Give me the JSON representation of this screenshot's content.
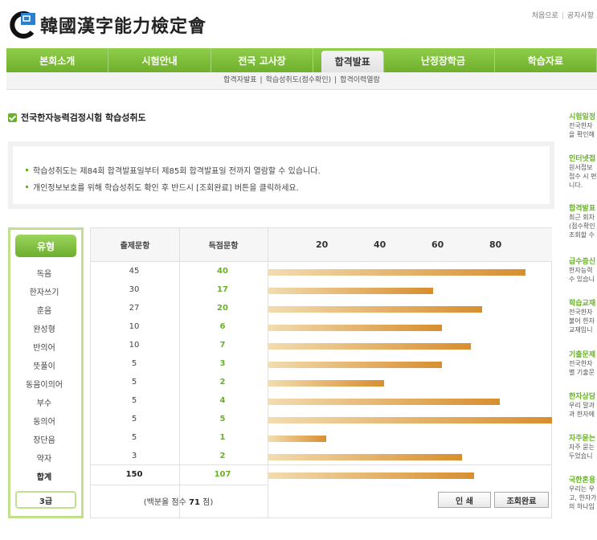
{
  "header": {
    "logo_text": "韓國漢字能力檢定會",
    "top_links": [
      "처음으로",
      "공지사항"
    ]
  },
  "nav": {
    "items": [
      "본회소개",
      "시험안내",
      "전국 고사장",
      "합격발표",
      "난정장학금",
      "학습자료"
    ],
    "active_index": 3
  },
  "subnav": {
    "items": [
      "합격자발표",
      "학습성취도(점수확인)",
      "합격이력열람"
    ],
    "separator": "|"
  },
  "section_title": "전국한자능력검정시험 학습성취도",
  "notice": [
    "학습성취도는 제84회 합격발표일부터 제85회 합격발표일 전까지 열람할 수 있습니다.",
    "개인정보보호를 위해 학습성취도 확인 후 반드시 [조회완료] 버튼을 클릭하세요."
  ],
  "table": {
    "type_label": "유형",
    "col_questions": "출제문항",
    "col_score": "득점문항",
    "axis_ticks": [
      "20",
      "40",
      "60",
      "80"
    ],
    "rows": [
      {
        "label": "독음",
        "questions": "45",
        "score": "40"
      },
      {
        "label": "한자쓰기",
        "questions": "30",
        "score": "17"
      },
      {
        "label": "훈음",
        "questions": "27",
        "score": "20"
      },
      {
        "label": "완성형",
        "questions": "10",
        "score": "6"
      },
      {
        "label": "반의어",
        "questions": "10",
        "score": "7"
      },
      {
        "label": "뜻풀이",
        "questions": "5",
        "score": "3"
      },
      {
        "label": "동음이의어",
        "questions": "5",
        "score": "2"
      },
      {
        "label": "부수",
        "questions": "5",
        "score": "4"
      },
      {
        "label": "동의어",
        "questions": "5",
        "score": "5"
      },
      {
        "label": "장단음",
        "questions": "5",
        "score": "1"
      },
      {
        "label": "약자",
        "questions": "3",
        "score": "2"
      }
    ],
    "total": {
      "label": "합계",
      "questions": "150",
      "score": "107"
    },
    "grade": "3급",
    "percent_prefix": "(백분율 점수",
    "percent_value": "71",
    "percent_suffix": "점)"
  },
  "chart_data": {
    "type": "bar",
    "orientation": "horizontal",
    "categories": [
      "독음",
      "한자쓰기",
      "훈음",
      "완성형",
      "반의어",
      "뜻풀이",
      "동음이의어",
      "부수",
      "동의어",
      "장단음",
      "약자",
      "합계"
    ],
    "values": [
      89,
      57,
      74,
      60,
      70,
      60,
      40,
      80,
      100,
      20,
      67,
      71
    ],
    "xlim": [
      0,
      100
    ],
    "xticks": [
      20,
      40,
      60,
      80
    ]
  },
  "buttons": {
    "print": "인 쇄",
    "done": "조회완료"
  },
  "sidebar": [
    {
      "title": "시험일정",
      "lines": [
        "전국한자",
        "을 확인해"
      ]
    },
    {
      "title": "인터넷접",
      "lines": [
        "원서접보",
        "접수 시 편",
        "니다."
      ]
    },
    {
      "title": "합격발표",
      "lines": [
        "최근 회차",
        "(점수확인",
        "조회할 수"
      ]
    },
    {
      "title": "급수증신",
      "lines": [
        "한자능력",
        "수 있습니"
      ]
    },
    {
      "title": "학습교재",
      "lines": [
        "전국한자",
        "불어 한자",
        "교재입니"
      ]
    },
    {
      "title": "기출문제",
      "lines": [
        "전국한자",
        "별 기출문"
      ]
    },
    {
      "title": "한자상담",
      "lines": [
        "우리 말과",
        "과 한자에"
      ]
    },
    {
      "title": "자주묻는",
      "lines": [
        "자주 묻는",
        "두었습니"
      ]
    },
    {
      "title": "국한혼용",
      "lines": [
        "우리는 우",
        "고, 한자가",
        "의 하나임"
      ]
    }
  ],
  "colors": {
    "nav_green": "#7bbd38",
    "accent_green": "#6ab02a",
    "bar_orange": "#d88e2e"
  }
}
